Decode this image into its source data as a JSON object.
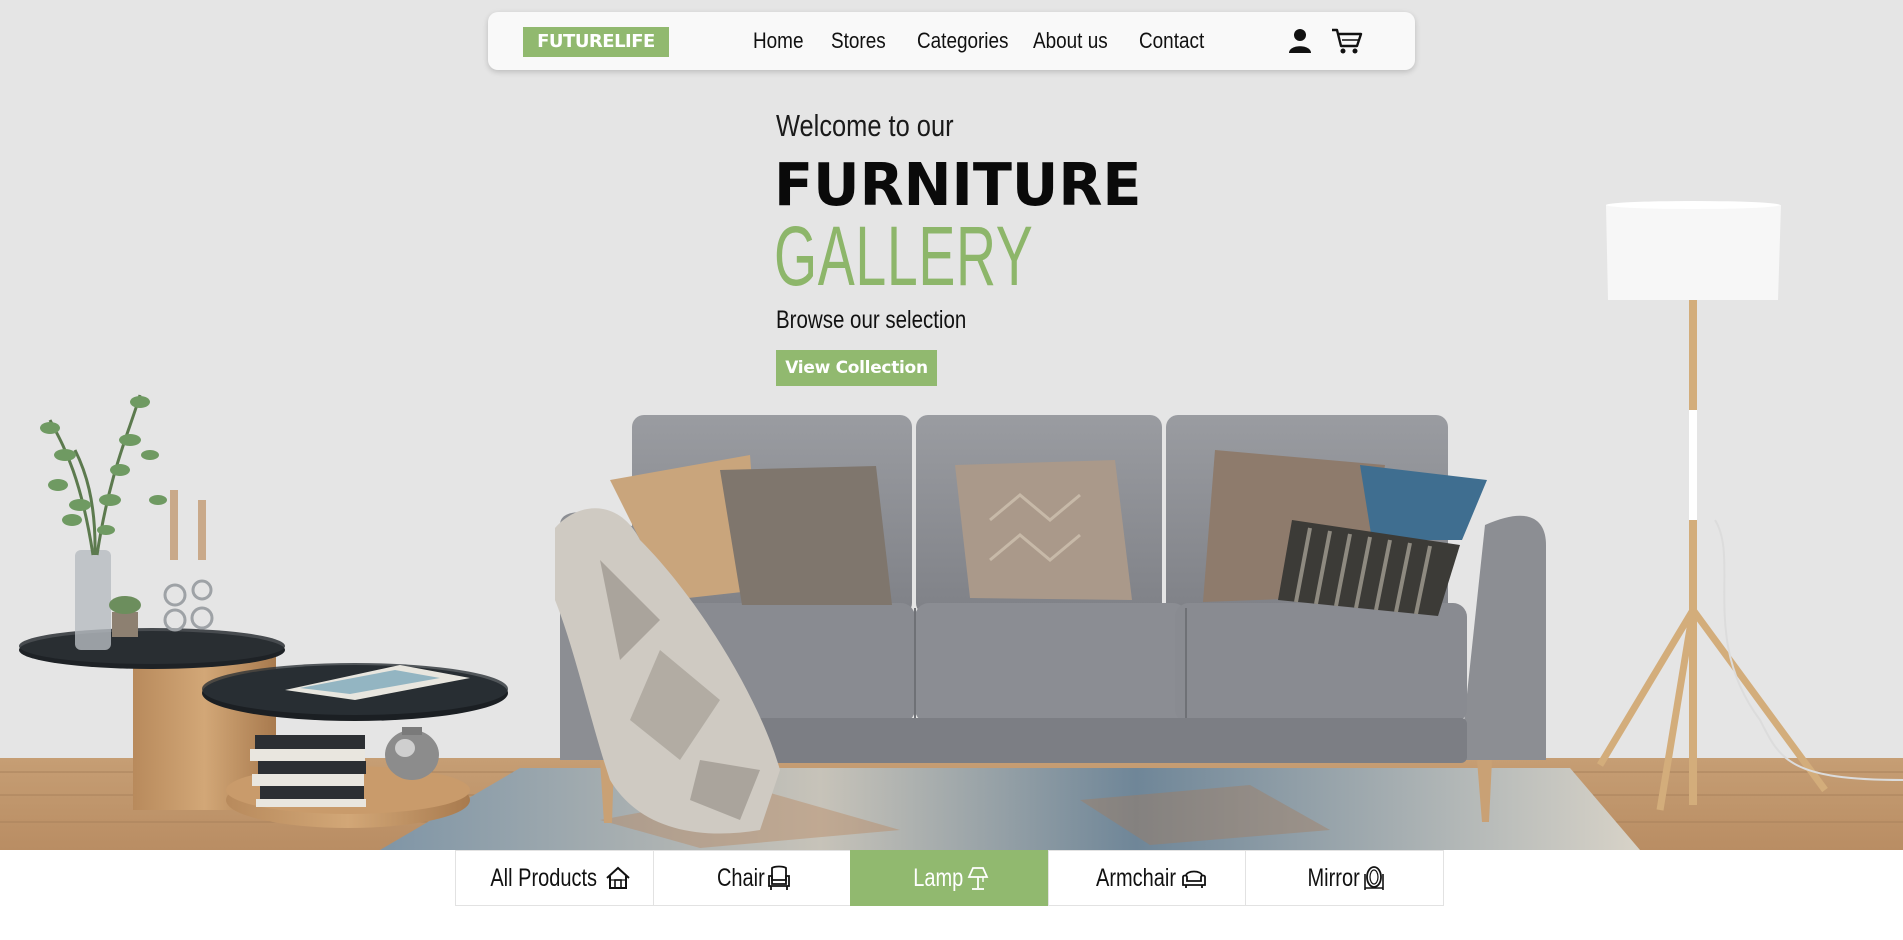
{
  "brand": {
    "logo_text": "FUTURELIFE",
    "accent_color": "#91b96f"
  },
  "nav": {
    "links": [
      {
        "label": "Home"
      },
      {
        "label": "Stores"
      },
      {
        "label": "Categories"
      },
      {
        "label": "About us"
      },
      {
        "label": "Contact"
      }
    ],
    "icons": [
      "user-icon",
      "cart-icon"
    ]
  },
  "hero": {
    "welcome": "Welcome to our",
    "title_line1": "FURNITURE",
    "title_line2": "GALLERY",
    "subtitle": "Browse our selection",
    "cta_label": "View Collection",
    "scene": [
      "sofa",
      "cushions",
      "throw-blanket",
      "rug",
      "side-tables",
      "plant-vase",
      "candle-holders",
      "books",
      "floor-lamp"
    ]
  },
  "categories": {
    "tabs": [
      {
        "label": "All Products",
        "icon": "house-icon",
        "active": false
      },
      {
        "label": "Chair",
        "icon": "chair-icon",
        "active": false
      },
      {
        "label": "Lamp",
        "icon": "lamp-icon",
        "active": true
      },
      {
        "label": "Armchair",
        "icon": "armchair-icon",
        "active": false
      },
      {
        "label": "Mirror",
        "icon": "mirror-icon",
        "active": false
      }
    ]
  }
}
